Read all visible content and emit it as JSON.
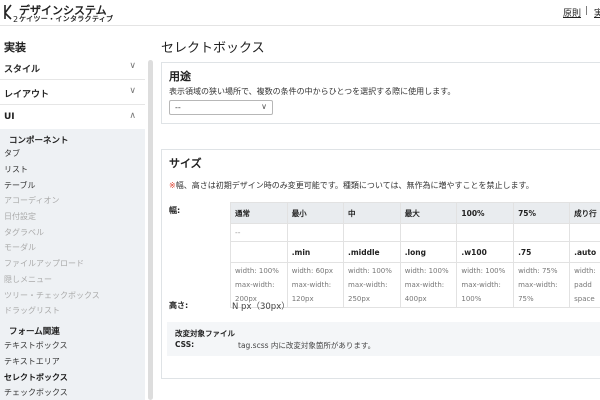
{
  "header": {
    "title": "デザインシステム",
    "subtitle": "ケイツー・インタラクティブ",
    "links": [
      "原則",
      "実"
    ],
    "separator": "|"
  },
  "sidebar": {
    "heading": "実装",
    "categories": [
      {
        "label": "スタイル",
        "chevron": "∨"
      },
      {
        "label": "レイアウト",
        "chevron": "∨"
      },
      {
        "label": "UI",
        "chevron": "∧"
      }
    ],
    "groups": [
      "コンポーネント",
      "フォーム関連"
    ],
    "components": [
      "タブ",
      "リスト",
      "テーブル",
      "アコーディオン",
      "日付設定",
      "タグラベル",
      "モーダル",
      "ファイルアップロード",
      "隠しメニュー",
      "ツリー・チェックボックス",
      "ドラッグリスト"
    ],
    "forms": [
      "テキストボックス",
      "テキストエリア",
      "セレクトボックス",
      "チェックボックス"
    ]
  },
  "page": {
    "title": "セレクトボックス"
  },
  "usage": {
    "title": "用途",
    "description": "表示領域の狭い場所で、複数の条件の中からひとつを選択する際に使用します。",
    "select_value": "--",
    "select_chevron": "∨"
  },
  "size": {
    "title": "サイズ",
    "warning_mark": "※",
    "warning": "幅、高さは初期デザイン時のみ変更可能です。種類については、無作為に増やすことを禁止します。",
    "width_label": "幅:",
    "table": {
      "headers": [
        "通常",
        "最小",
        "中",
        "最大",
        "100%",
        "75%",
        "成り行"
      ],
      "row1": [
        "--",
        "",
        "",
        "",
        "",
        "",
        ""
      ],
      "row2": [
        "",
        ".min",
        ".middle",
        ".long",
        ".w100",
        ".75",
        ".auto"
      ],
      "row3_line1": [
        "width: 100%",
        "width: 60px",
        "width: 100%",
        "width: 100%",
        "width: 100%",
        "width: 75%",
        "width:"
      ],
      "row3_line2": [
        "max-width:",
        "max-width:",
        "max-width:",
        "max-width:",
        "max-width:",
        "max-width:",
        "padd"
      ],
      "row3_line3": [
        "200px",
        "120px",
        "250px",
        "400px",
        "100%",
        "75%",
        "space"
      ]
    },
    "height_label": "高さ:",
    "height_value": "N px（30px）",
    "modify": {
      "title": "改変対象ファイル",
      "key": "CSS:",
      "value": "tag.scss 内に改変対象箇所があります。"
    }
  }
}
